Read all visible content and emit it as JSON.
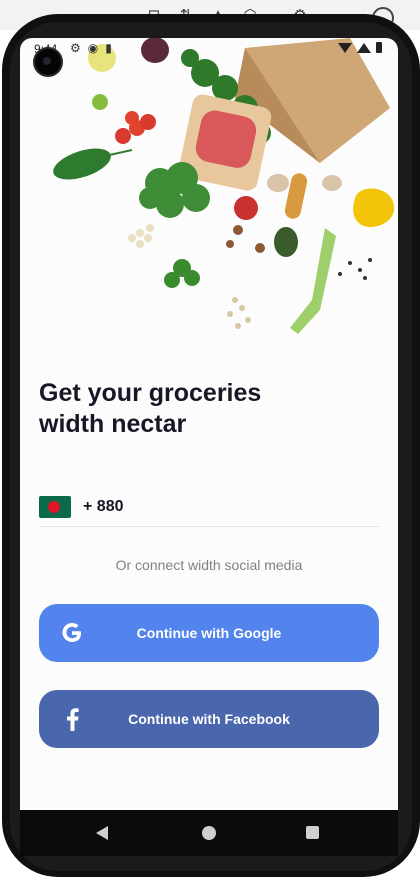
{
  "status_bar": {
    "time": "9:44",
    "icons": [
      "gear-icon",
      "app-icon",
      "sd-card-icon",
      "wifi-icon",
      "signal-icon",
      "battery-icon"
    ]
  },
  "onboarding": {
    "title": "Get your groceries\nwidth nectar",
    "country_code": "+ 880",
    "country_flag": "bangladesh-flag",
    "social_note": "Or connect width social media"
  },
  "buttons": {
    "google_label": "Continue with Google",
    "facebook_label": "Continue with Facebook"
  },
  "colors": {
    "google": "#5383ec",
    "facebook": "#4a66ac",
    "title": "#181725",
    "note": "#828282"
  },
  "nav": [
    "back-icon",
    "home-icon",
    "recents-icon"
  ]
}
